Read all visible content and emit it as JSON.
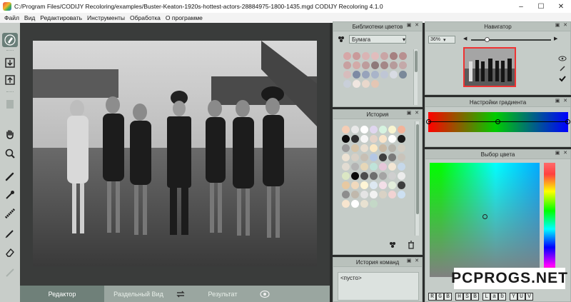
{
  "window": {
    "title": "C:/Program Files/CODIJY Recoloring/examples/Buster-Keaton-1920s-hottest-actors-28884975-1800-1435.mgd CODIJY Recoloring 4.1.0",
    "controls": [
      "–",
      "☐",
      "✕"
    ]
  },
  "menu": [
    "Файл",
    "Вид",
    "Редактировать",
    "Инструменты",
    "Обработка",
    "О программе"
  ],
  "tools": [
    "pen-icon",
    "import-icon",
    "export-icon",
    "hand-icon",
    "zoom-icon",
    "brush-icon",
    "dropper-icon",
    "pattern-icon",
    "pencil-icon",
    "eraser-icon",
    "line-icon"
  ],
  "bottom_tabs": {
    "editor": "Редактор",
    "split": "Раздельный Вид",
    "result": "Результат"
  },
  "libraries": {
    "title": "Библиотеки цветов",
    "selected": "Бумага",
    "colors": [
      "#d6a7a7",
      "#c99a9a",
      "#dab4b4",
      "#e1bdbd",
      "#c9a5a5",
      "#a58080",
      "#b89090",
      "#c8a0a0",
      "#d3aaa8",
      "#bd9c9c",
      "#8e7a7a",
      "#a48787",
      "#b69b9b",
      "#c4a9a9",
      "#d7bcbc",
      "#7c8aa4",
      "#97a3bb",
      "#a9b4c9",
      "#bfc6d5",
      "#d8dbe3",
      "#7a8899",
      "#c9cfd9",
      "#f0e6e0",
      "#e9d8cc",
      "#e4c6b4"
    ]
  },
  "history": {
    "title": "История",
    "colors": [
      "#f4cdb5",
      "#e8e8e8",
      "#ffffff",
      "#e0d6ef",
      "#d6f3e0",
      "#f8f4d0",
      "#f2b39a",
      "#0b0b0b",
      "#2f2f2f",
      "#f6f6f6",
      "#e5d3c8",
      "#f9e4c9",
      "#ffffff",
      "#1a1a1a",
      "#9a9a9a",
      "#d6c4a8",
      "#e8ded0",
      "#fbe8c3",
      "#c9b9a4",
      "#b6b3ab",
      "#d3cdc2",
      "#ede3d4",
      "#d8d0c6",
      "#c7bfb4",
      "#b4c7e5",
      "#3e3e3e",
      "#7a7a7a",
      "#c9c3ba",
      "#e2dcd2",
      "#b3b3b3",
      "#e6d7b8",
      "#bfe3d9",
      "#e6c7d9",
      "#f2e6d4",
      "#c6d8ea",
      "#dbe7c4",
      "#0a0a0a",
      "#4d4d4d",
      "#6e6e6e",
      "#a4a4a4",
      "#cfcfcf",
      "#ececec",
      "#e7c9a2",
      "#f0d9bd",
      "#fff5d6",
      "#dde8f1",
      "#f3dfe8",
      "#e3eedc",
      "#3d3d3d",
      "#8d8d8d",
      "#c0b8ac",
      "#e4e4e4",
      "#f2f2f2",
      "#d9d2c5",
      "#f1d3d3",
      "#cde0f2",
      "#f7e5cf",
      "#ffffff",
      "#e8e1d1",
      "#c4d8c7"
    ]
  },
  "commands": {
    "title": "История команд",
    "empty": "<пусто>"
  },
  "navigator": {
    "title": "Навигатор",
    "zoom": "36%",
    "zoom_level": 0.2
  },
  "gradient": {
    "title": "Настройки градиента",
    "stops": [
      "#ff0000",
      "#00cc00",
      "#0000ff"
    ]
  },
  "picker": {
    "title": "Выбор цвета",
    "modes": [
      [
        "R",
        "G",
        "B"
      ],
      [
        "H",
        "S",
        "B"
      ],
      [
        "L",
        "a",
        "b"
      ],
      [
        "Y",
        "U",
        "V"
      ]
    ]
  },
  "watermark": "PCPROGS.NET"
}
